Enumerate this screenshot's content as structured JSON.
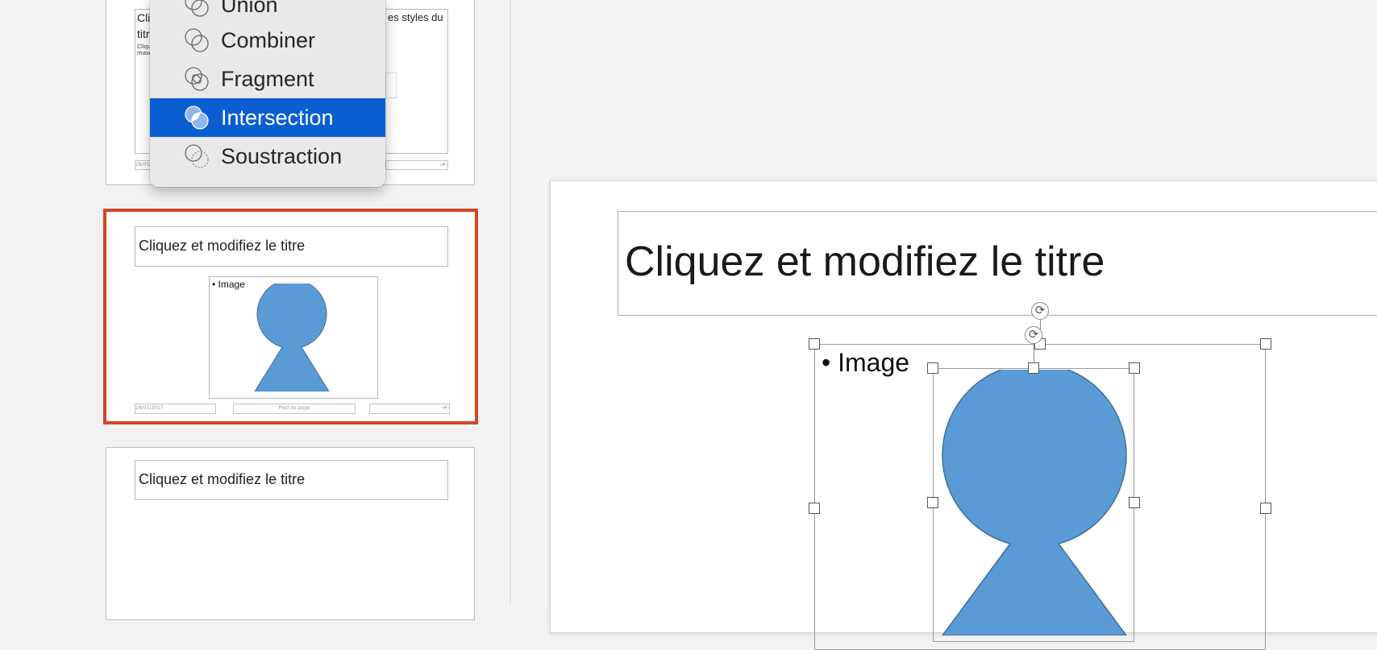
{
  "merge_menu": {
    "items": [
      {
        "label": "Union",
        "icon": "union-icon"
      },
      {
        "label": "Combiner",
        "icon": "combine-icon"
      },
      {
        "label": "Fragment",
        "icon": "fragment-icon"
      },
      {
        "label": "Intersection",
        "icon": "intersect-icon",
        "selected": true
      },
      {
        "label": "Soustraction",
        "icon": "subtract-icon"
      }
    ]
  },
  "thumbs": {
    "t1": {
      "title_frag": "Cli",
      "title_frag2": "titr",
      "text_right": "es styles du",
      "tiny1": "Cliqu",
      "tiny2": "masq",
      "date": "28/05/",
      "page": "‹#›"
    },
    "t2": {
      "title": "Cliquez et modifiez le titre",
      "bullet": "• Image",
      "date": "28/05/2017",
      "footer": "Pied de page",
      "page": "‹#›"
    },
    "t3": {
      "title": "Cliquez et modifiez le titre"
    }
  },
  "slide": {
    "title": "Cliquez et modifiez le titre",
    "bullet": "• Image"
  },
  "colors": {
    "shape_fill": "#5b9bd5",
    "selection_border": "#d24726",
    "menu_highlight": "#0a5ed1"
  }
}
